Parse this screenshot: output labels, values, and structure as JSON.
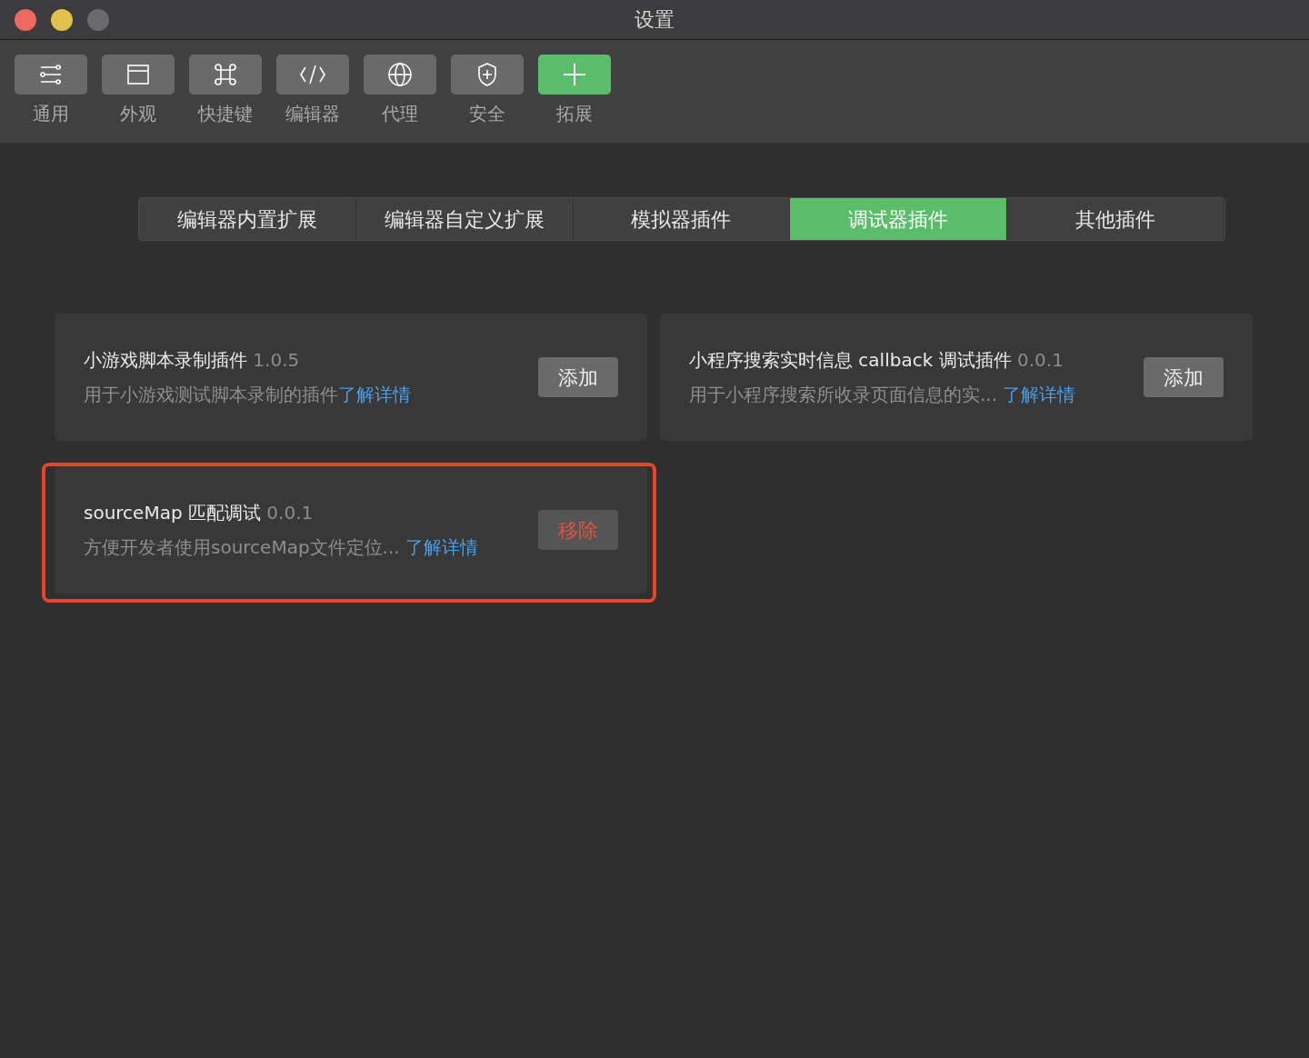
{
  "window": {
    "title": "设置"
  },
  "toolbar": [
    {
      "label": "通用",
      "selected": false
    },
    {
      "label": "外观",
      "selected": false
    },
    {
      "label": "快捷键",
      "selected": false
    },
    {
      "label": "编辑器",
      "selected": false
    },
    {
      "label": "代理",
      "selected": false
    },
    {
      "label": "安全",
      "selected": false
    },
    {
      "label": "拓展",
      "selected": true
    }
  ],
  "tabs": [
    {
      "label": "编辑器内置扩展",
      "selected": false
    },
    {
      "label": "编辑器自定义扩展",
      "selected": false
    },
    {
      "label": "模拟器插件",
      "selected": false
    },
    {
      "label": "调试器插件",
      "selected": true
    },
    {
      "label": "其他插件",
      "selected": false
    }
  ],
  "plugins": [
    {
      "name": "小游戏脚本录制插件",
      "version": "1.0.5",
      "description": "用于小游戏测试脚本录制的插件",
      "link": "了解详情",
      "button": "添加",
      "kind": "add",
      "highlighted": false
    },
    {
      "name": "小程序搜索实时信息 callback 调试插件",
      "version": "0.0.1",
      "description": "用于小程序搜索所收录页面信息的实...",
      "link": "了解详情",
      "button": "添加",
      "kind": "add",
      "highlighted": false
    },
    {
      "name": "sourceMap 匹配调试",
      "version": "0.0.1",
      "description": "方便开发者使用sourceMap文件定位...",
      "link": "了解详情",
      "button": "移除",
      "kind": "remove",
      "highlighted": true
    }
  ]
}
